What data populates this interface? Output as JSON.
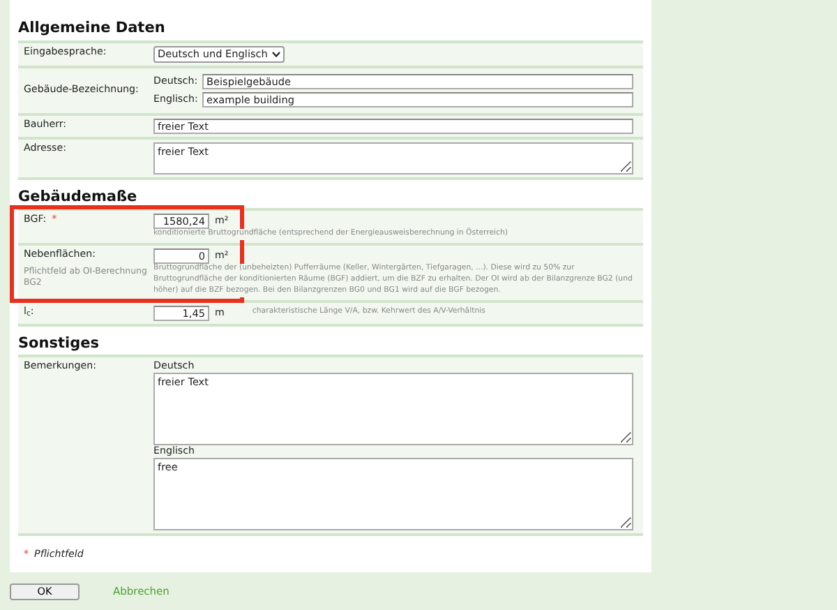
{
  "sections": [
    {
      "title": "Allgemeine Daten",
      "rows": [
        {
          "kind": "select",
          "label": "Eingabesprache:",
          "value": "Deutsch und Englisch"
        },
        {
          "kind": "bilingual",
          "label": "Gebäude-Bezeichnung:",
          "fields": [
            {
              "label": "Deutsch:",
              "value": "Beispielgebäude"
            },
            {
              "label": "Englisch:",
              "value": "example building"
            }
          ]
        },
        {
          "kind": "text",
          "label": "Bauherr:",
          "value": "freier Text"
        },
        {
          "kind": "textarea",
          "label": "Adresse:",
          "value": "freier Text"
        }
      ]
    },
    {
      "title": "Gebäudemaße",
      "rows": [
        {
          "kind": "number",
          "label": "BGF:",
          "required_mark": "*",
          "value": "1580,24",
          "unit": "m²",
          "hint": "konditionierte Bruttogrundfläche (entsprechend der Energieausweisberechnung in Österreich)",
          "highlighted": true
        },
        {
          "kind": "number",
          "label": "Nebenflächen:",
          "sublabel": "Pflichtfeld ab OI-Berechnung BG2",
          "value": "0",
          "unit": "m²",
          "hint": "Bruttogrundfläche der (unbeheizten) Pufferräume (Keller, Wintergärten, Tiefgaragen, ...). Diese wird zu 50% zur Bruttogrundfläche der konditionierten Räume (BGF) addiert, um die BZF zu erhalten. Der OI wird ab der Bilanzgrenze BG2 (und höher) auf die BZF bezogen. Bei den Bilanzgrenzen BG0 und BG1 wird auf die BGF bezogen.",
          "highlighted": true
        },
        {
          "kind": "number_inline",
          "label": "l$_{c}$:",
          "value": "1,45",
          "unit": "m",
          "hint": "charakteristische Länge V/A, bzw. Kehrwert des A/V-Verhältnis",
          "highlighted": false
        }
      ]
    },
    {
      "title": "Sonstiges",
      "rows": [
        {
          "kind": "stacked_textareas",
          "label": "Bemerkungen:",
          "fields": [
            {
              "label": "Deutsch",
              "value": "freier Text"
            },
            {
              "label": "Englisch",
              "value": "free"
            }
          ]
        }
      ]
    }
  ],
  "required_note": {
    "mark": "*",
    "text": "Pflichtfeld"
  },
  "buttons": {
    "ok": "OK",
    "cancel": "Abbrechen"
  }
}
